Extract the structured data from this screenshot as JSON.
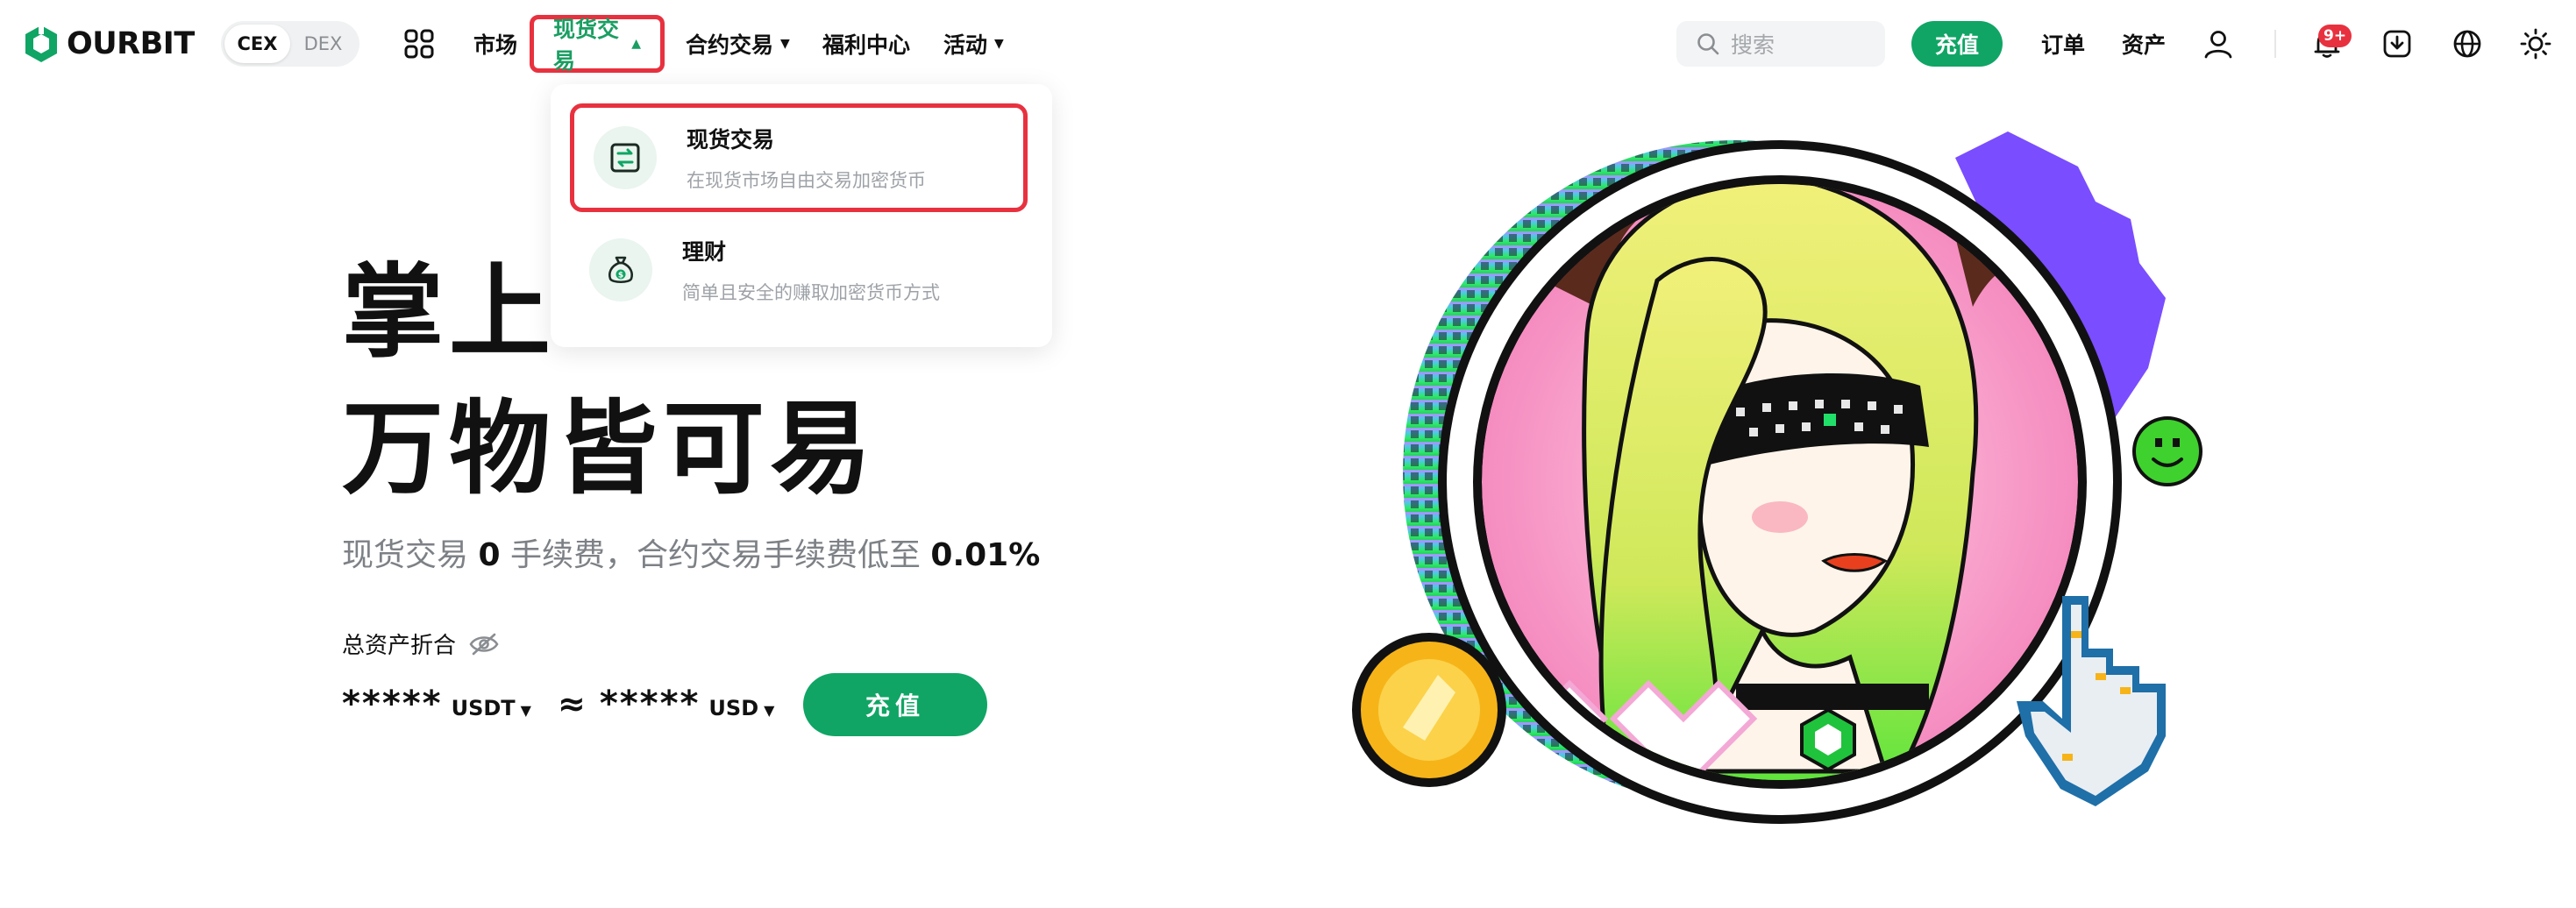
{
  "brand": {
    "name": "OURBIT"
  },
  "mode_switch": {
    "options": [
      "CEX",
      "DEX"
    ],
    "active": "CEX"
  },
  "nav": {
    "market": "市场",
    "spot": "现货交易",
    "futures": "合约交易",
    "welfare": "福利中心",
    "events": "活动"
  },
  "search": {
    "placeholder": "搜索"
  },
  "header_actions": {
    "deposit": "充值",
    "orders": "订单",
    "assets": "资产",
    "notification_badge": "9+"
  },
  "dropdown": {
    "items": [
      {
        "title": "现货交易",
        "desc": "在现货市场自由交易加密货币",
        "icon": "swap-icon"
      },
      {
        "title": "理财",
        "desc": "简单且安全的赚取加密货币方式",
        "icon": "money-bag-icon"
      }
    ]
  },
  "hero": {
    "line1": "掌上",
    "line2": "万物皆可易",
    "sub_prefix": "现货交易 ",
    "sub_zero": "0",
    "sub_mid": " 手续费，合约交易手续费低至 ",
    "sub_rate": "0.01%"
  },
  "balance": {
    "label": "总资产折合",
    "masked_value": "*****",
    "unit_primary": "USDT",
    "approx": "≈",
    "masked_value_2": "*****",
    "unit_secondary": "USD",
    "deposit_button": "充值"
  },
  "colors": {
    "brand_green": "#10a565",
    "highlight_red": "#e8313f",
    "text_muted": "#7d8186"
  }
}
